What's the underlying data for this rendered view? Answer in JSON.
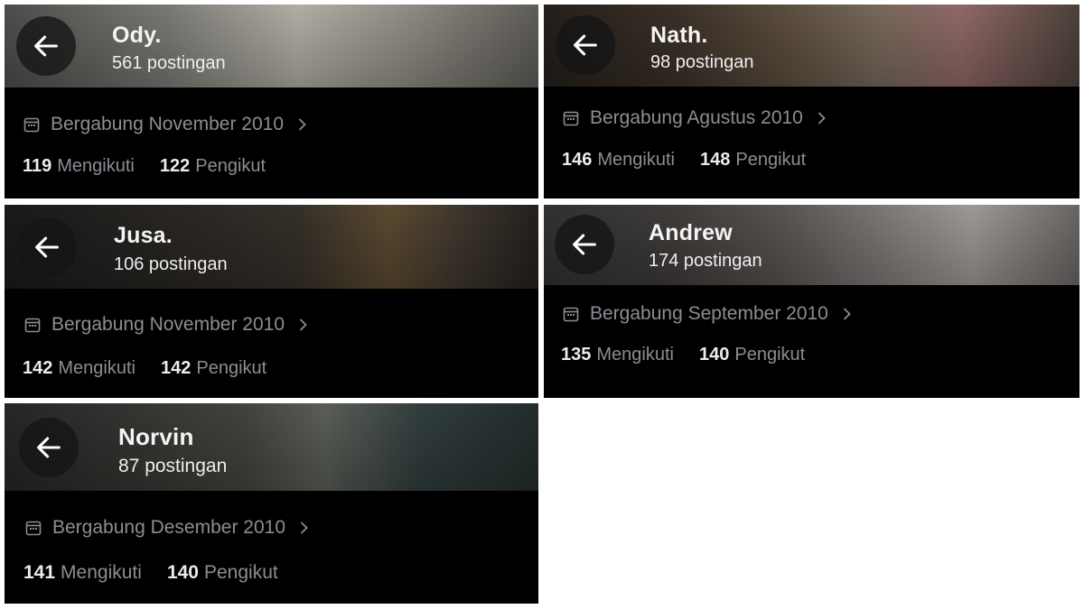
{
  "cards": [
    {
      "name": "Ody.",
      "posts": "561 postingan",
      "joined": "Bergabung November 2010",
      "following_count": "119",
      "following_label": "Mengikuti",
      "followers_count": "122",
      "followers_label": "Pengikut"
    },
    {
      "name": "Nath.",
      "posts": "98 postingan",
      "joined": "Bergabung Agustus 2010",
      "following_count": "146",
      "following_label": "Mengikuti",
      "followers_count": "148",
      "followers_label": "Pengikut"
    },
    {
      "name": "Jusa.",
      "posts": "106 postingan",
      "joined": "Bergabung November 2010",
      "following_count": "142",
      "following_label": "Mengikuti",
      "followers_count": "142",
      "followers_label": "Pengikut"
    },
    {
      "name": "Andrew",
      "posts": "174 postingan",
      "joined": "Bergabung September 2010",
      "following_count": "135",
      "following_label": "Mengikuti",
      "followers_count": "140",
      "followers_label": "Pengikut"
    },
    {
      "name": "Norvin",
      "posts": "87 postingan",
      "joined": "Bergabung Desember 2010",
      "following_count": "141",
      "following_label": "Mengikuti",
      "followers_count": "140",
      "followers_label": "Pengikut"
    }
  ]
}
